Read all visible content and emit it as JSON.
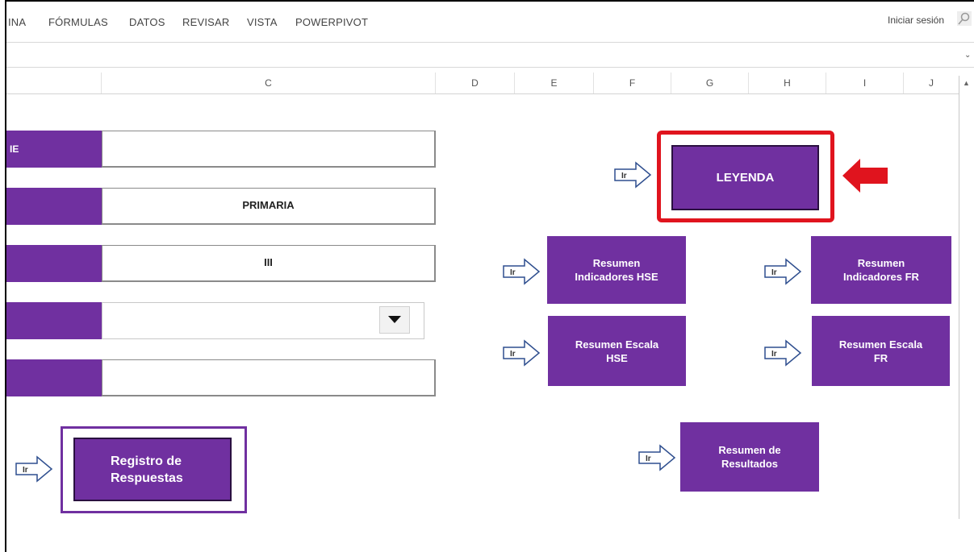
{
  "ribbon": {
    "tabs": [
      "INA",
      "FÓRMULAS",
      "DATOS",
      "REVISAR",
      "VISTA",
      "POWERPIVOT"
    ],
    "signin": "Iniciar sesión"
  },
  "columns": [
    "C",
    "D",
    "E",
    "F",
    "G",
    "H",
    "I",
    "J"
  ],
  "form": {
    "row1_label": "IE",
    "row1_value": "",
    "row2_value": "PRIMARIA",
    "row3_value": "III",
    "row4_value": "",
    "row5_value": ""
  },
  "buttons": {
    "leyenda": "LEYENDA",
    "resumen_ind_hse": [
      "Resumen",
      "Indicadores HSE"
    ],
    "resumen_ind_fr": [
      "Resumen",
      "Indicadores FR"
    ],
    "resumen_esc_hse": [
      "Resumen Escala",
      "HSE"
    ],
    "resumen_esc_fr": [
      "Resumen Escala",
      "FR"
    ],
    "resumen_resultados": [
      "Resumen de",
      "Resultados"
    ],
    "registro": [
      "Registro de",
      "Respuestas"
    ]
  },
  "ir_label": "Ir",
  "colors": {
    "purple": "#7030a0",
    "red": "#e0141e"
  },
  "icons": [
    "search-icon",
    "chevron-down-icon",
    "dropdown-arrow-icon",
    "ir-arrow-icon",
    "red-arrow-icon"
  ]
}
